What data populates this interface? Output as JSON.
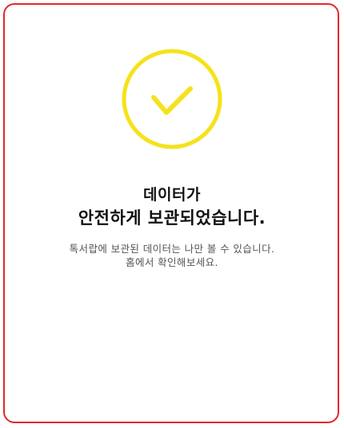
{
  "status": {
    "icon": "check-circle-icon",
    "accent_color": "#f5e21c",
    "border_color": "#e3262d"
  },
  "message": {
    "title_line1": "데이터가",
    "title_line2": "안전하게 보관되었습니다.",
    "description_line1": "톡서랍에 보관된 데이터는 나만 볼 수 있습니다.",
    "description_line2": "홈에서 확인해보세요."
  }
}
